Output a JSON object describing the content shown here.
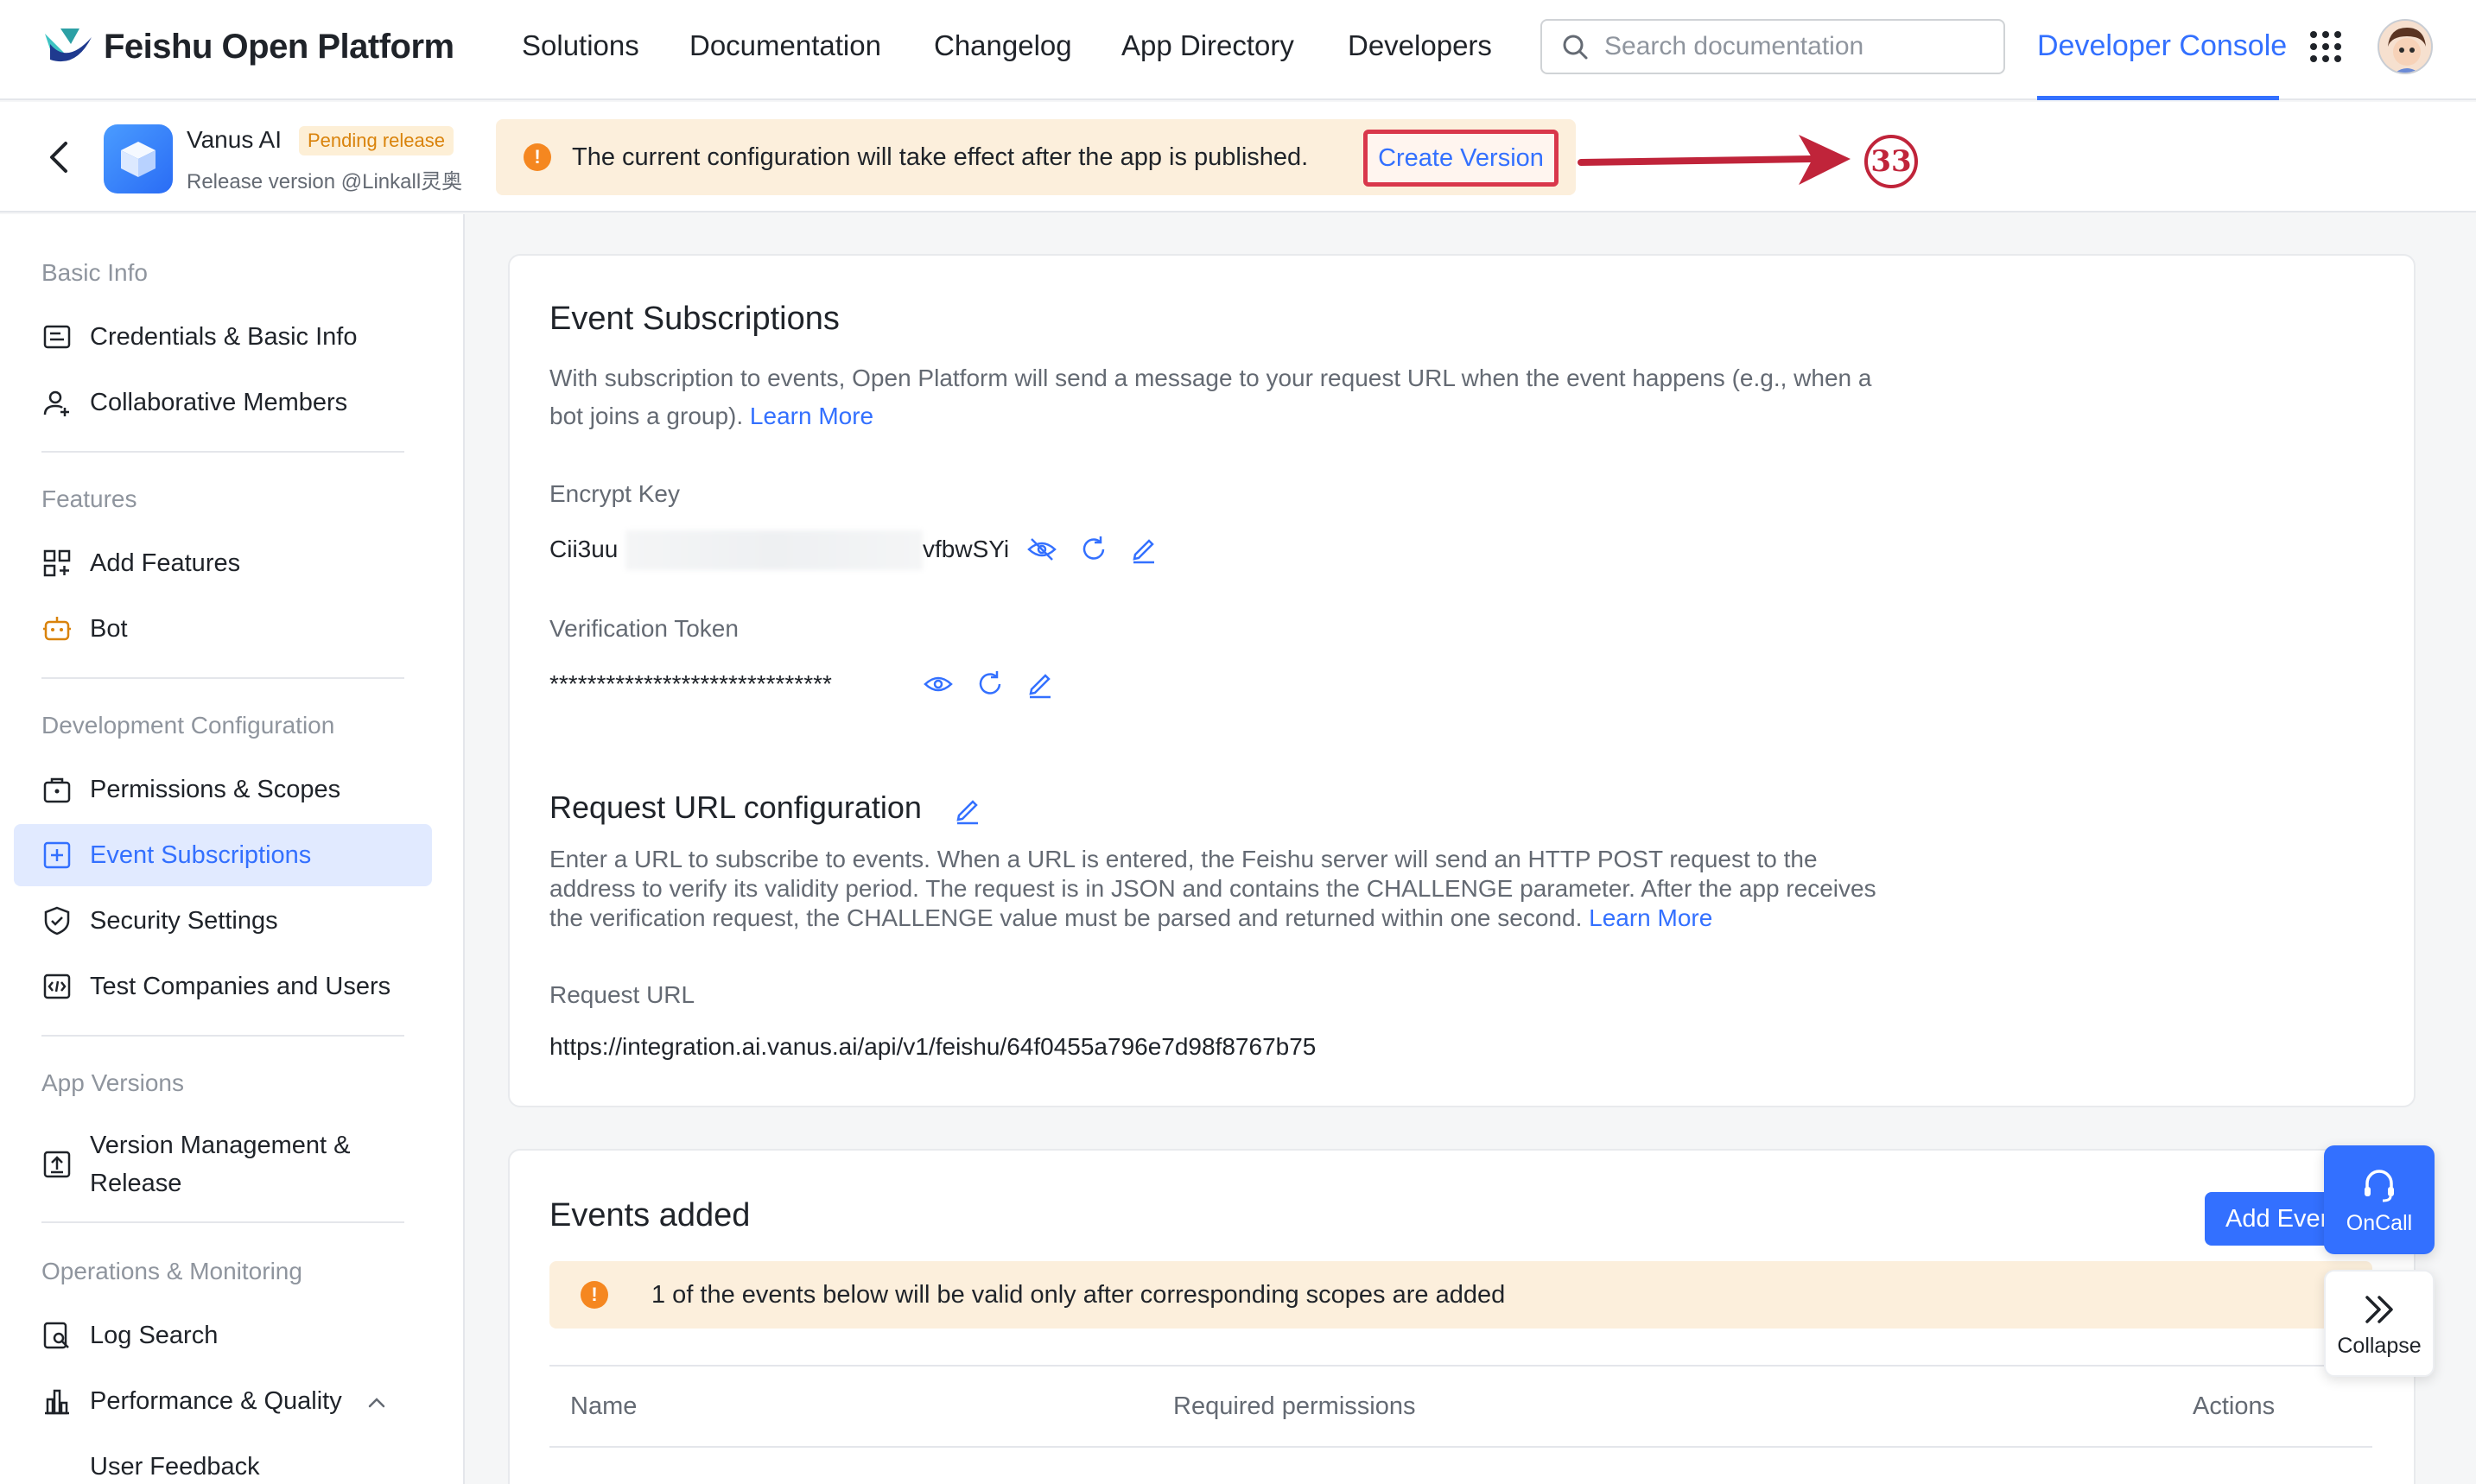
{
  "topnav": {
    "brand": "Feishu Open Platform",
    "links": [
      "Solutions",
      "Documentation",
      "Changelog",
      "App Directory",
      "Developers"
    ],
    "search_placeholder": "Search documentation",
    "developer_console": "Developer Console"
  },
  "app": {
    "name": "Vanus AI",
    "status_badge": "Pending release",
    "release_version": "Release version @Linkall灵奥",
    "notice": "The current configuration will take effect after the app is published.",
    "create_version": "Create Version",
    "annotation_number": "33"
  },
  "sidebar": {
    "groups": {
      "basic_info": "Basic Info",
      "features": "Features",
      "dev_config": "Development Configuration",
      "app_versions": "App Versions",
      "ops": "Operations & Monitoring"
    },
    "items": {
      "credentials": "Credentials & Basic Info",
      "members": "Collaborative Members",
      "add_features": "Add Features",
      "bot": "Bot",
      "permissions": "Permissions & Scopes",
      "events": "Event Subscriptions",
      "security": "Security Settings",
      "test": "Test Companies and Users",
      "version_mgmt_1": "Version Management &",
      "version_mgmt_2": "Release",
      "log_search": "Log Search",
      "performance": "Performance & Quality",
      "user_feedback": "User Feedback"
    }
  },
  "event_subscriptions": {
    "title": "Event Subscriptions",
    "desc_line1": "With subscription to events, Open Platform will send a message to your request URL when the event happens (e.g., when a",
    "desc_line2": "bot joins a group).",
    "learn_more": "Learn More",
    "encrypt_key_label": "Encrypt Key",
    "encrypt_key_prefix": "Cii3uu",
    "encrypt_key_suffix": "vfbwSYi",
    "verification_token_label": "Verification Token",
    "verification_token_value": "******************************"
  },
  "request_url_config": {
    "title": "Request URL configuration",
    "desc_line1": "Enter a URL to subscribe to events. When a URL is entered, the Feishu server will send an HTTP POST request to the",
    "desc_line2": "address to verify its validity period. The request is in JSON and contains the CHALLENGE parameter. After the app receives",
    "desc_line3": "the verification request, the CHALLENGE value must be parsed and returned within one second.",
    "learn_more": "Learn More",
    "request_url_label": "Request URL",
    "request_url_value": "https://integration.ai.vanus.ai/api/v1/feishu/64f0455a796e7d98f8767b75"
  },
  "events_added": {
    "title": "Events added",
    "add_button": "Add Events",
    "warning": "1 of the events below will be valid only after corresponding scopes are added",
    "columns": [
      "Name",
      "Required permissions",
      "Actions"
    ]
  },
  "floating": {
    "oncall": "OnCall",
    "collapse": "Collapse"
  },
  "colors": {
    "accent": "#3370ff",
    "warning_bg": "#fcefdc",
    "warning_icon": "#f58720",
    "annotation_red": "#d9374b"
  }
}
